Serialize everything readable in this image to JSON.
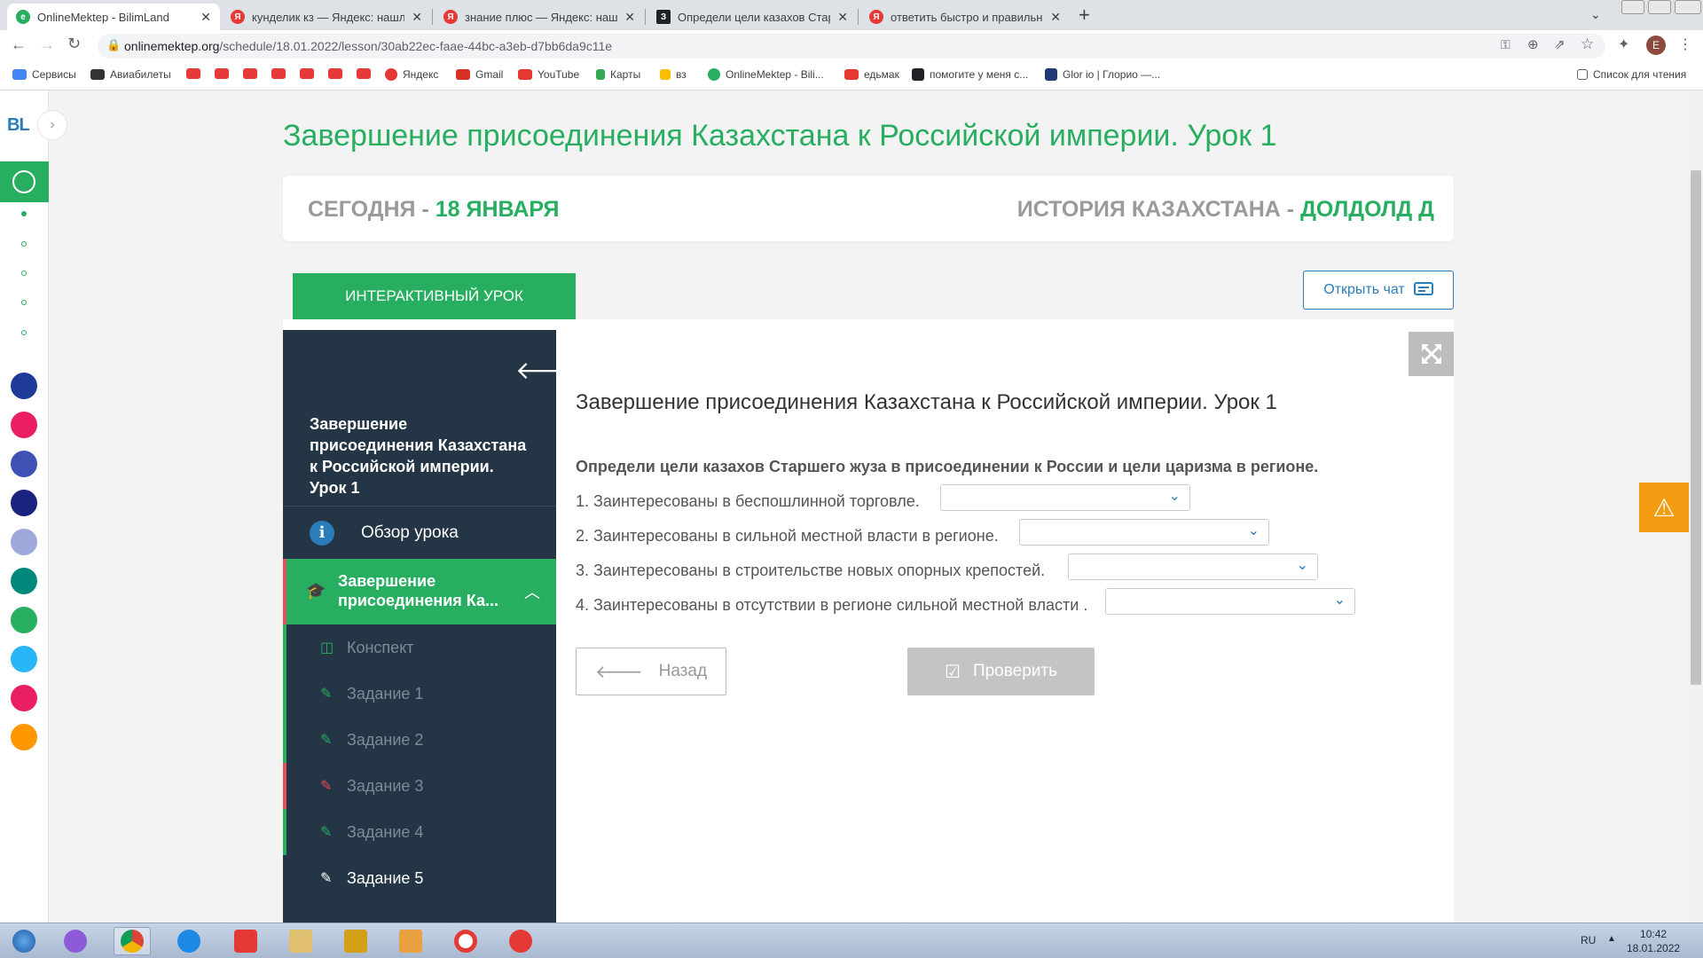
{
  "browser": {
    "tabs": [
      {
        "title": "OnlineMektep - BilimLand",
        "icon_color": "#27ae60",
        "active": true
      },
      {
        "title": "кунделик кз — Яндекс: нашлось",
        "icon_color": "#e53935",
        "active": false
      },
      {
        "title": "знание плюс — Яндекс: нашлось",
        "icon_color": "#e53935",
        "active": false
      },
      {
        "title": "Определи цели казахов Старше",
        "icon_color": "#202124",
        "active": false
      },
      {
        "title": "ответить быстро и правильно –",
        "icon_color": "#e53935",
        "active": false
      }
    ],
    "new_tab": "+",
    "close_glyph": "✕",
    "url_domain": "onlinemektep.org",
    "url_path": "/schedule/18.01.2022/lesson/30ab22ec-faae-44bc-a3eb-d7bb6da9c11e",
    "profile_initial": "E",
    "bookmarks": [
      {
        "label": "Сервисы",
        "color": "#4285f4"
      },
      {
        "label": "Авиабилеты",
        "color": "#333333"
      },
      {
        "label": "",
        "color": "#e53935"
      },
      {
        "label": "",
        "color": "#e53935"
      },
      {
        "label": "",
        "color": "#e53935"
      },
      {
        "label": "",
        "color": "#e53935"
      },
      {
        "label": "",
        "color": "#e53935"
      },
      {
        "label": "",
        "color": "#e53935"
      },
      {
        "label": "",
        "color": "#e53935"
      },
      {
        "label": "Яндекс",
        "color": "#e53935"
      },
      {
        "label": "Gmail",
        "color": "#d93025"
      },
      {
        "label": "YouTube",
        "color": "#e53935"
      },
      {
        "label": "Карты",
        "color": "#34a853"
      },
      {
        "label": "вз",
        "color": "#fbbc04"
      },
      {
        "label": "OnlineMektep - Bili...",
        "color": "#27ae60"
      },
      {
        "label": "едьмак",
        "color": "#e53935"
      },
      {
        "label": "помогите у меня с...",
        "color": "#202124"
      },
      {
        "label": "Glor io | Глорио —...",
        "color": "#1f3b73"
      }
    ],
    "reading_list": "Список для чтения"
  },
  "header": {
    "lesson_title": "Завершение присоединения Казахстана к Российской империи. Урок 1",
    "today_label": "СЕГОДНЯ - ",
    "today_date": "18 ЯНВАРЯ",
    "subject_label": "ИСТОРИЯ КАЗАХСТАНА - ",
    "student": "ДОЛДОЛД Д"
  },
  "tabs": {
    "interactive": "ИНТЕРАКТИВНЫЙ УРОК",
    "open_chat": "Открыть чат"
  },
  "sidebar": {
    "title": "Завершение присоединения Казахстана к Российской империи. Урок 1",
    "overview": "Обзор урока",
    "active_section": "Завершение присоединения Ка...",
    "items": [
      {
        "label": "Конспект",
        "icon": "📖",
        "icon_color": "#27ae60"
      },
      {
        "label": "Задание 1",
        "icon": "✎",
        "icon_color": "#27ae60"
      },
      {
        "label": "Задание 2",
        "icon": "✎",
        "icon_color": "#27ae60"
      },
      {
        "label": "Задание 3",
        "icon": "✎",
        "icon_color": "#e74c5c"
      },
      {
        "label": "Задание 4",
        "icon": "✎",
        "icon_color": "#27ae60"
      },
      {
        "label": "Задание 5",
        "icon": "✎",
        "icon_color": "#ffffff"
      }
    ]
  },
  "task": {
    "title": "Завершение присоединения Казахстана к Российской империи. Урок 1",
    "question": "Определи цели казахов Старшего жуза в присоединении к России и цели царизма в регионе.",
    "lines": [
      {
        "text": "1. Заинтересованы в беспошлинной торговле.",
        "selected": ""
      },
      {
        "text": "2. Заинтересованы в сильной местной власти в регионе.",
        "selected": ""
      },
      {
        "text": "3. Заинтересованы в строительстве новых опорных крепостей.",
        "selected": ""
      },
      {
        "text": "4. Заинтересованы в отсутствии в регионе сильной местной власти .",
        "selected": ""
      }
    ],
    "back": "Назад",
    "check": "Проверить"
  },
  "rail": [
    {
      "color": "#1f3b9a"
    },
    {
      "color": "#e91e63"
    },
    {
      "color": "#3f51b5"
    },
    {
      "color": "#1a237e"
    },
    {
      "color": "#7986cb"
    },
    {
      "color": "#00897b"
    },
    {
      "color": "#27ae60"
    },
    {
      "color": "#29b6f6"
    },
    {
      "color": "#e91e63"
    },
    {
      "color": "#ff9800"
    }
  ],
  "taskbar": {
    "lang": "RU",
    "time": "10:42",
    "date": "18.01.2022"
  },
  "colors": {
    "accent": "#27ae60",
    "sidebar_bg": "#243645",
    "link": "#2a7db9",
    "warning": "#f39c12"
  }
}
